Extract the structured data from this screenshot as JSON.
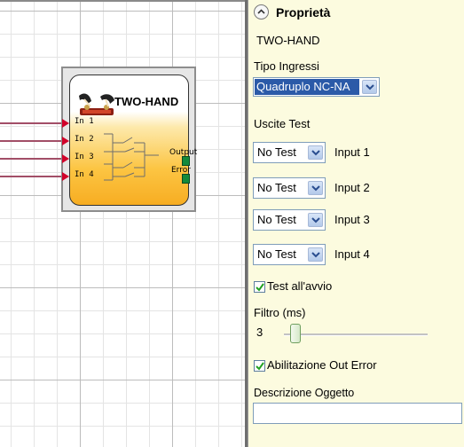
{
  "block": {
    "title": "TWO-HAND",
    "inputs": [
      "In 1",
      "In 2",
      "In 3",
      "In 4"
    ],
    "outputs": [
      "Output",
      "Error"
    ]
  },
  "panel": {
    "title": "Proprietà",
    "object_name": "TWO-HAND",
    "tipo_ingressi_label": "Tipo Ingressi",
    "tipo_ingressi_value": "Quadruplo NC-NA",
    "uscite_test_label": "Uscite Test",
    "test_outputs": [
      {
        "value": "No Test",
        "label": "Input 1"
      },
      {
        "value": "No Test",
        "label": "Input 2"
      },
      {
        "value": "No Test",
        "label": "Input 3"
      },
      {
        "value": "No Test",
        "label": "Input 4"
      }
    ],
    "test_avvio": {
      "label": "Test all'avvio",
      "checked": true
    },
    "filtro": {
      "label": "Filtro (ms)",
      "value": "3"
    },
    "abilitazione_out_error": {
      "label": "Abilitazione Out Error",
      "checked": true
    },
    "descrizione_label": "Descrizione Oggetto",
    "descrizione_value": ""
  },
  "colors": {
    "panel_background": "#fcfbdf",
    "selection": "#2b5aa8",
    "block_gradient_end": "#f7ad22",
    "input_pin": "#d1002a",
    "output_port": "#138a3c",
    "wire": "#a24e67"
  },
  "icons": [
    "two-hand-icon",
    "chevron-up-icon",
    "chevron-down-icon",
    "checkmark-icon",
    "switch-contacts-icon"
  ]
}
